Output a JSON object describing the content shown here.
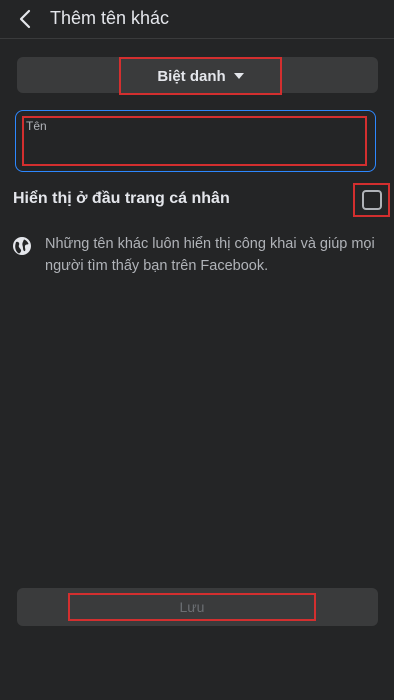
{
  "header": {
    "title": "Thêm tên khác"
  },
  "form": {
    "type_label": "Biệt danh",
    "name_placeholder": "Tên",
    "name_value": "",
    "show_on_profile_label": "Hiển thị ở đầu trang cá nhân",
    "show_on_profile_checked": false,
    "info_text": "Những tên khác luôn hiển thị công khai và giúp mọi người tìm thấy bạn trên Facebook.",
    "save_label": "Lưu"
  },
  "colors": {
    "background": "#242526",
    "field_bg": "#3a3b3c",
    "focus_border": "#2d88ff",
    "annotation_red": "#d32f2f"
  },
  "icons": {
    "back": "back-arrow-icon",
    "dropdown": "caret-down-icon",
    "info": "globe-icon"
  }
}
